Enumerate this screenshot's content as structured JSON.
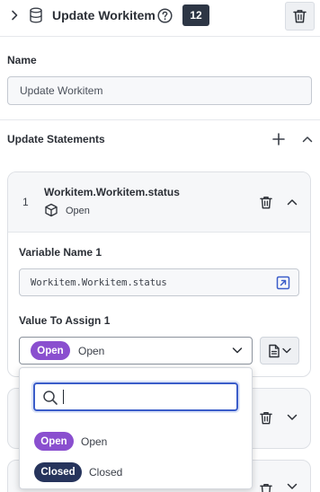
{
  "header": {
    "title": "Update Workitem",
    "badge_count": "12",
    "icons": [
      "chevron-right-icon",
      "database-icon",
      "help-circle-icon",
      "trash-icon"
    ]
  },
  "name_field": {
    "label": "Name",
    "value": "Update Workitem"
  },
  "update_statements": {
    "label": "Update Statements",
    "icons": [
      "plus-icon",
      "chevron-up-icon"
    ]
  },
  "statement_1": {
    "index": "1",
    "title": "Workitem.Workitem.status",
    "subtitle": "Open",
    "variable_label": "Variable Name 1",
    "variable_value": "Workitem.Workitem.status",
    "value_label": "Value To Assign 1",
    "selected_pill": "Open",
    "selected_text": "Open"
  },
  "dropdown": {
    "search_value": "",
    "options": [
      {
        "pill": "Open",
        "text": "Open",
        "color": "#8a4fcf"
      },
      {
        "pill": "Closed",
        "text": "Closed",
        "color": "#26345c"
      }
    ]
  },
  "colors": {
    "accent_blue": "#3b5dc9",
    "open_purple": "#8a4fcf",
    "closed_navy": "#26345c",
    "badge_dark": "#2d3645"
  }
}
